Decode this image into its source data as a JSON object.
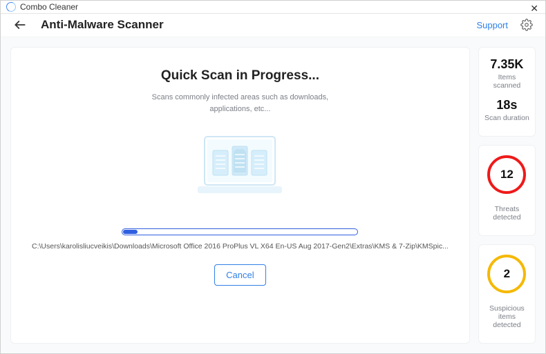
{
  "app": {
    "title": "Combo Cleaner"
  },
  "header": {
    "title": "Anti-Malware Scanner",
    "support_label": "Support"
  },
  "scan": {
    "title": "Quick Scan in Progress...",
    "description_line1": "Scans commonly infected areas such as downloads,",
    "description_line2": "applications, etc...",
    "progress_percent": 6,
    "current_path": "C:\\Users\\karolisliucveikis\\Downloads\\Microsoft Office 2016 ProPlus VL X64 En-US Aug 2017-Gen2\\Extras\\KMS & 7-Zip\\KMSpic...",
    "cancel_label": "Cancel"
  },
  "stats": {
    "items_value": "7.35K",
    "items_label": "Items scanned",
    "duration_value": "18s",
    "duration_label": "Scan duration",
    "threats_value": "12",
    "threats_label": "Threats detected",
    "suspicious_value": "2",
    "suspicious_label": "Suspicious items detected"
  },
  "colors": {
    "accent": "#2f7fe6",
    "progress": "#2f5fe0",
    "threat_ring": "#ef1a1a",
    "suspicious_ring": "#f5b800"
  }
}
